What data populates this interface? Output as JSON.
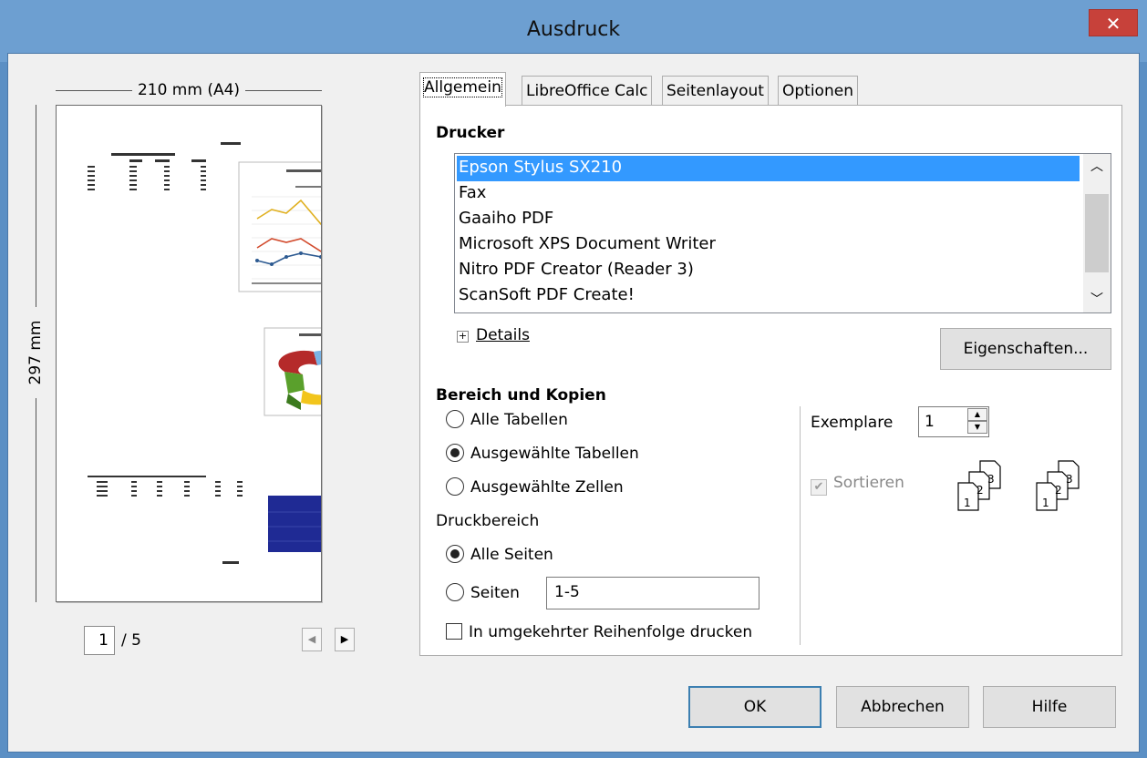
{
  "window": {
    "title": "Ausdruck",
    "close_glyph": "✕"
  },
  "preview": {
    "width_label": "210 mm (A4)",
    "height_label": "297 mm",
    "page_number": "1",
    "page_total": "/ 5",
    "prev_glyph": "◀",
    "next_glyph": "▶"
  },
  "tabs": [
    {
      "label": "Allgemein",
      "active": true
    },
    {
      "label": "LibreOffice Calc",
      "active": false
    },
    {
      "label": "Seitenlayout",
      "active": false
    },
    {
      "label": "Optionen",
      "active": false
    }
  ],
  "printer": {
    "section_title": "Drucker",
    "items": [
      "Epson Stylus SX210",
      "Fax",
      "Gaaiho PDF",
      "Microsoft XPS Document Writer",
      "Nitro PDF Creator (Reader 3)",
      "ScanSoft PDF Create!"
    ],
    "selected_index": 0,
    "details_label": "Details",
    "properties_button": "Eigenschaften..."
  },
  "range": {
    "section_title": "Bereich und Kopien",
    "options": [
      "Alle Tabellen",
      "Ausgewählte Tabellen",
      "Ausgewählte Zellen"
    ],
    "selected_option": 1,
    "print_range_title": "Druckbereich",
    "all_pages_label": "Alle Seiten",
    "pages_label": "Seiten",
    "pages_value": "1-5",
    "pages_selected": "all",
    "reverse_label": "In umgekehrter Reihenfolge drucken",
    "reverse_checked": false
  },
  "copies": {
    "label": "Exemplare",
    "value": "1",
    "collate_label": "Sortieren",
    "collate_checked": true,
    "collate_enabled": false
  },
  "buttons": {
    "ok": "OK",
    "cancel": "Abbrechen",
    "help": "Hilfe"
  },
  "colors": {
    "titlebar": "#6d9fd1",
    "close": "#c7413a",
    "selection": "#3399ff",
    "dialog_bg": "#f0f0f0"
  }
}
